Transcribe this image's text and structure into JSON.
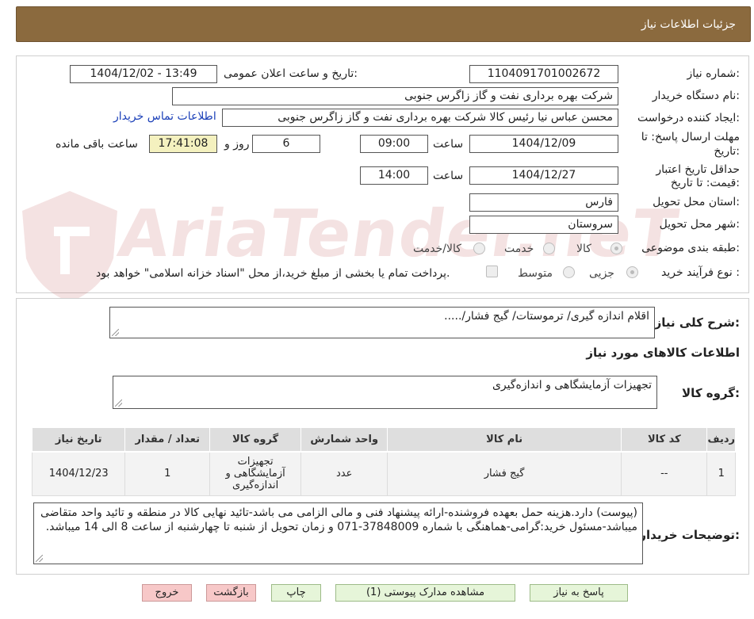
{
  "header": {
    "title": "جزئیات اطلاعات نیاز"
  },
  "watermark": {
    "text": "AriaTender.neT"
  },
  "form": {
    "need_number_label": "شماره نیاز:",
    "need_number": "1104091701002672",
    "announce_label": "تاریخ و ساعت اعلان عمومی:",
    "announce_value": "1404/12/02 - 13:49",
    "buyer_label": "نام دستگاه خریدار:",
    "buyer_value": "شرکت بهره برداری نفت و گاز زاگرس جنوبی",
    "creator_label": "ایجاد کننده درخواست:",
    "creator_value": "محسن عباس نیا رئیس کالا شرکت بهره برداری نفت و گاز زاگرس جنوبی",
    "contact_link": "اطلاعات تماس خریدار",
    "deadline_label_1": "مهلت ارسال پاسخ: تا",
    "deadline_label_2": "تاریخ:",
    "deadline_date": "1404/12/09",
    "time_label": "ساعت",
    "deadline_time": "09:00",
    "days_value": "6",
    "days_label": "روز و",
    "remaining_time": "17:41:08",
    "remaining_label": "ساعت باقی مانده",
    "validity_label_1": "حداقل تاریخ اعتبار",
    "validity_label_2": "قیمت: تا تاریخ:",
    "validity_date": "1404/12/27",
    "validity_time_label": "ساعت",
    "validity_time": "14:00",
    "province_label": "استان محل تحویل:",
    "province_value": "فارس",
    "city_label": "شهر محل تحویل:",
    "city_value": "سروستان",
    "category_label": "طبقه بندی موضوعی:",
    "category_options": [
      "کالا",
      "خدمت",
      "کالا/خدمت"
    ],
    "category_selected": "کالا",
    "process_label": "نوع فرآیند خرید :",
    "process_options": [
      "جزیی",
      "متوسط"
    ],
    "process_selected": "جزیی",
    "payment_note": "پرداخت تمام یا بخشی از مبلغ خرید،از محل \"اسناد خزانه اسلامی\" خواهد بود."
  },
  "details": {
    "summary_label": "شرح کلی نیاز:",
    "summary_value": "اقلام اندازه گیری/ ترموستات/ گیج فشار/.....",
    "goods_info_title": "اطلاعات کالاهای مورد نیاز",
    "goods_group_label": "گروه کالا:",
    "goods_group_value": "تجهیزات آزمایشگاهی و اندازه‌گیری",
    "table": {
      "headers": [
        "ردیف",
        "کد کالا",
        "نام کالا",
        "واحد شمارش",
        "گروه کالا",
        "تعداد / مقدار",
        "تاریخ نیاز"
      ],
      "rows": [
        [
          "1",
          "--",
          "گیج فشار",
          "عدد",
          "تجهیزات آزمایشگاهی و اندازه‌گیری",
          "1",
          "1404/12/23"
        ]
      ]
    },
    "buyer_notes_label": "توضیحات خریدار:",
    "buyer_notes_value": "(پیوست) دارد.هزینه حمل بعهده فروشنده-ارائه پیشنهاد فنی و مالی الزامی می باشد-تائید نهایی کالا در منطقه و تائید واحد متقاضی میباشد-مسئول خرید:گرامی-هماهنگی با شماره 37848009-071 و زمان تحویل از شنبه تا چهارشنبه از ساعت 8 الی 14 میباشد."
  },
  "buttons": {
    "reply": "پاسخ به نیاز",
    "view_docs": "مشاهده مدارک پیوستی (1)",
    "print": "چاپ",
    "back": "بازگشت",
    "exit": "خروج"
  }
}
